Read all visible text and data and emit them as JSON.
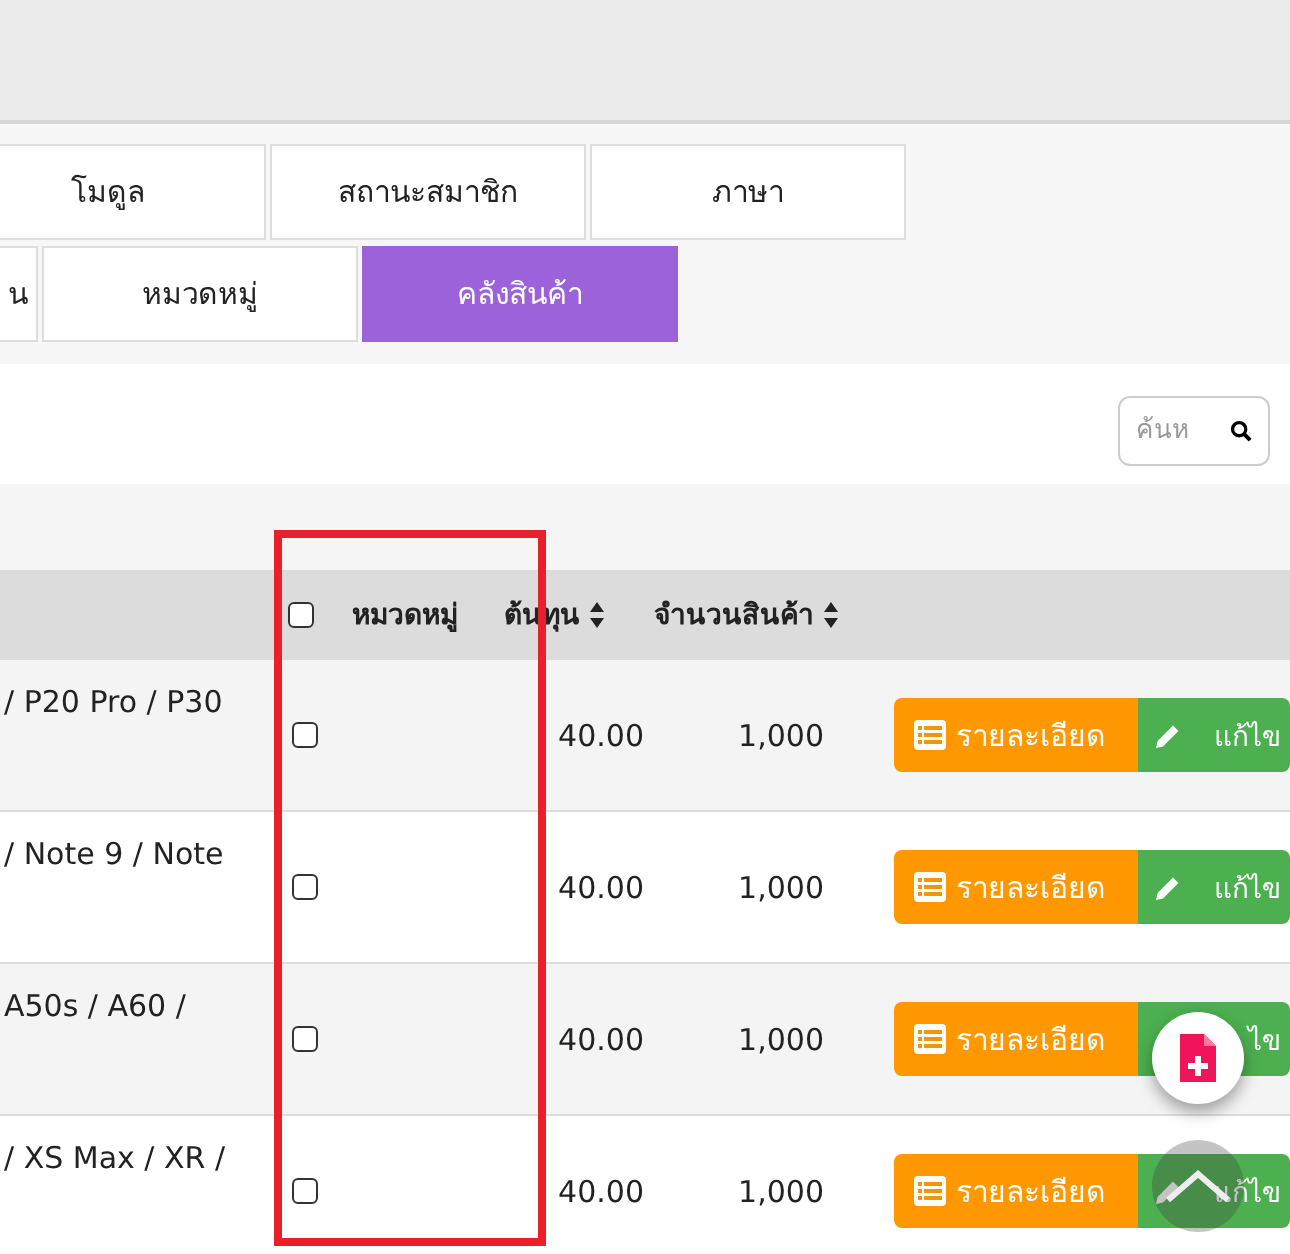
{
  "tabs": [
    [
      {
        "label": "โมดูล",
        "selected": false
      },
      {
        "label": "สถานะสมาชิก",
        "selected": false
      },
      {
        "label": "ภาษา",
        "selected": false
      }
    ],
    [
      {
        "label": "น",
        "selected": false
      },
      {
        "label": "หมวดหมู่",
        "selected": false
      },
      {
        "label": "คลังสินค้า",
        "selected": true
      }
    ]
  ],
  "search": {
    "placeholder": "ค้นห"
  },
  "table": {
    "select_all": {
      "checked": false
    },
    "columns": [
      {
        "label": "หมวดหมู่",
        "sortable": false
      },
      {
        "label": "ต้นทุน",
        "sortable": true
      },
      {
        "label": "จำนวนสินค้า",
        "sortable": true
      }
    ],
    "rows": [
      {
        "name": "/ P20 Pro / P30",
        "checked": false,
        "cost": "40.00",
        "quantity": "1,000",
        "detail_button": "รายละเอียด",
        "edit_button": "แก้ไข"
      },
      {
        "name": "/ Note 9 / Note",
        "checked": false,
        "cost": "40.00",
        "quantity": "1,000",
        "detail_button": "รายละเอียด",
        "edit_button": "แก้ไข"
      },
      {
        "name": "A50s / A60 /",
        "checked": false,
        "cost": "40.00",
        "quantity": "1,000",
        "detail_button": "รายละเอียด",
        "edit_button": "ไข",
        "edit_icon": false
      },
      {
        "name": "/ XS Max / XR /",
        "checked": false,
        "cost": "40.00",
        "quantity": "1,000",
        "detail_button": "รายละเอียด",
        "edit_button": "แก้ไข"
      }
    ]
  }
}
